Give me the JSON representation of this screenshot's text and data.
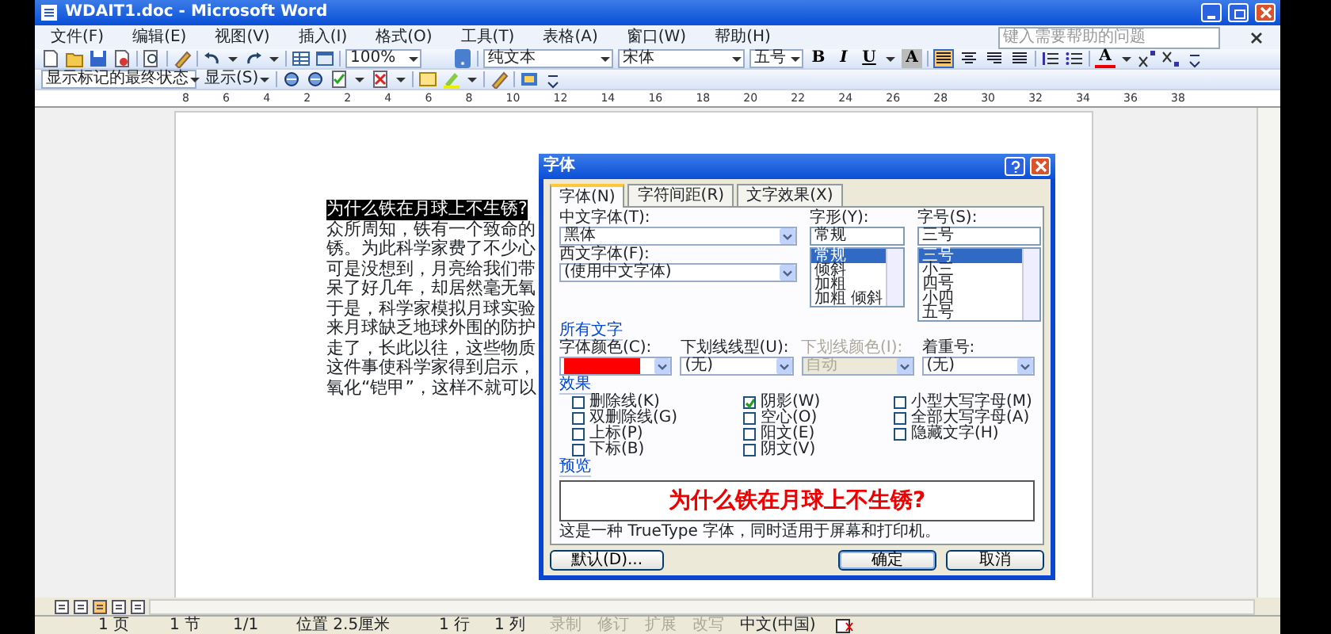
{
  "window": {
    "title": "WDAIT1.doc - Microsoft Word"
  },
  "menu": [
    "文件(F)",
    "编辑(E)",
    "视图(V)",
    "插入(I)",
    "格式(O)",
    "工具(T)",
    "表格(A)",
    "窗口(W)",
    "帮助(H)"
  ],
  "help_box": {
    "placeholder": "键入需要帮助的问题"
  },
  "formatting_toolbar": {
    "zoom": "100%",
    "style": "纯文本",
    "font": "宋体",
    "size": "五号",
    "text_buttons": [
      "B",
      "I",
      "U"
    ],
    "shading_button": "A",
    "font_color_button": "A",
    "alignment": [
      {
        "selected": true
      },
      {
        "selected": false
      },
      {
        "selected": false
      },
      {
        "selected": false
      }
    ]
  },
  "reviewing_toolbar": {
    "display": "显示标记的最终状态",
    "show": "显示(S)"
  },
  "ruler": [
    "8",
    "6",
    "4",
    "2",
    "2",
    "4",
    "6",
    "8",
    "10",
    "12",
    "14",
    "16",
    "18",
    "20",
    "22",
    "24",
    "26",
    "28",
    "30",
    "32",
    "34",
    "36",
    "38"
  ],
  "document": {
    "title": {
      "text": "为什么铁在月球上不生锈?",
      "selected": true
    },
    "lines": [
      "众所周知，铁有一个致命的",
      "锈。为此科学家费了不少心",
      "可是没想到，月亮给我们带",
      "呆了好几年，却居然毫无氧",
      "于是，科学家模拟月球实验",
      "来月球缺乏地球外围的防护",
      "走了，长此以往，这些物质",
      "这件事使科学家得到启示，",
      "氧化“铠甲”，这样不就可以"
    ]
  },
  "dialog": {
    "title": "字体",
    "tabs": [
      {
        "label": "字体(N)",
        "selected": true
      },
      {
        "label": "字符间距(R)",
        "selected": false
      },
      {
        "label": "文字效果(X)",
        "selected": false
      }
    ],
    "chinese_font": {
      "label": "中文字体(T):",
      "value": "黑体"
    },
    "western_font": {
      "label": "西文字体(F):",
      "value": "(使用中文字体)"
    },
    "font_style": {
      "label": "字形(Y):",
      "value": "常规",
      "options": [
        {
          "text": "常规",
          "selected": true
        },
        {
          "text": "倾斜",
          "selected": false
        },
        {
          "text": "加粗",
          "selected": false
        },
        {
          "text": "加粗 倾斜",
          "selected": false
        }
      ]
    },
    "font_size": {
      "label": "字号(S):",
      "value": "三号",
      "options": [
        {
          "text": "三号",
          "selected": true
        },
        {
          "text": "小三",
          "selected": false
        },
        {
          "text": "四号",
          "selected": false
        },
        {
          "text": "小四",
          "selected": false
        },
        {
          "text": "五号",
          "selected": false
        }
      ]
    },
    "all_text_heading": "所有文字",
    "font_color": {
      "label": "字体颜色(C):",
      "color": "#ff0000"
    },
    "underline_style": {
      "label": "下划线线型(U):",
      "value": "(无)",
      "disabled": false
    },
    "underline_color": {
      "label": "下划线颜色(I):",
      "value": "自动",
      "disabled": true
    },
    "emphasis_mark": {
      "label": "着重号:",
      "value": "(无)",
      "disabled": false
    },
    "effects_heading": "效果",
    "effects": [
      [
        {
          "label": "删除线(K)",
          "checked": false
        },
        {
          "label": "双删除线(G)",
          "checked": false
        },
        {
          "label": "上标(P)",
          "checked": false
        },
        {
          "label": "下标(B)",
          "checked": false
        }
      ],
      [
        {
          "label": "阴影(W)",
          "checked": true
        },
        {
          "label": "空心(O)",
          "checked": false
        },
        {
          "label": "阳文(E)",
          "checked": false
        },
        {
          "label": "阴文(V)",
          "checked": false
        }
      ],
      [
        {
          "label": "小型大写字母(M)",
          "checked": false
        },
        {
          "label": "全部大写字母(A)",
          "checked": false
        },
        {
          "label": "隐藏文字(H)",
          "checked": false
        }
      ]
    ],
    "preview_heading": "预览",
    "preview_text": "为什么铁在月球上不生锈?",
    "note": "这是一种 TrueType 字体，同时适用于屏幕和打印机。",
    "buttons": [
      {
        "label": "默认(D)...",
        "default": false
      },
      {
        "label": "确定",
        "default": true
      },
      {
        "label": "取消",
        "default": false
      }
    ]
  },
  "status_bar": [
    {
      "text": "1 页",
      "disabled": false
    },
    {
      "text": "1 节",
      "disabled": false
    },
    {
      "text": "1/1",
      "disabled": false
    },
    {
      "text": "位置 2.5厘米",
      "disabled": false
    },
    {
      "text": "1 行",
      "disabled": false
    },
    {
      "text": "1 列",
      "disabled": false
    },
    {
      "text": "录制",
      "disabled": true
    },
    {
      "text": "修订",
      "disabled": true
    },
    {
      "text": "扩展",
      "disabled": true
    },
    {
      "text": "改写",
      "disabled": true
    },
    {
      "text": "中文(中国)",
      "disabled": false
    }
  ]
}
